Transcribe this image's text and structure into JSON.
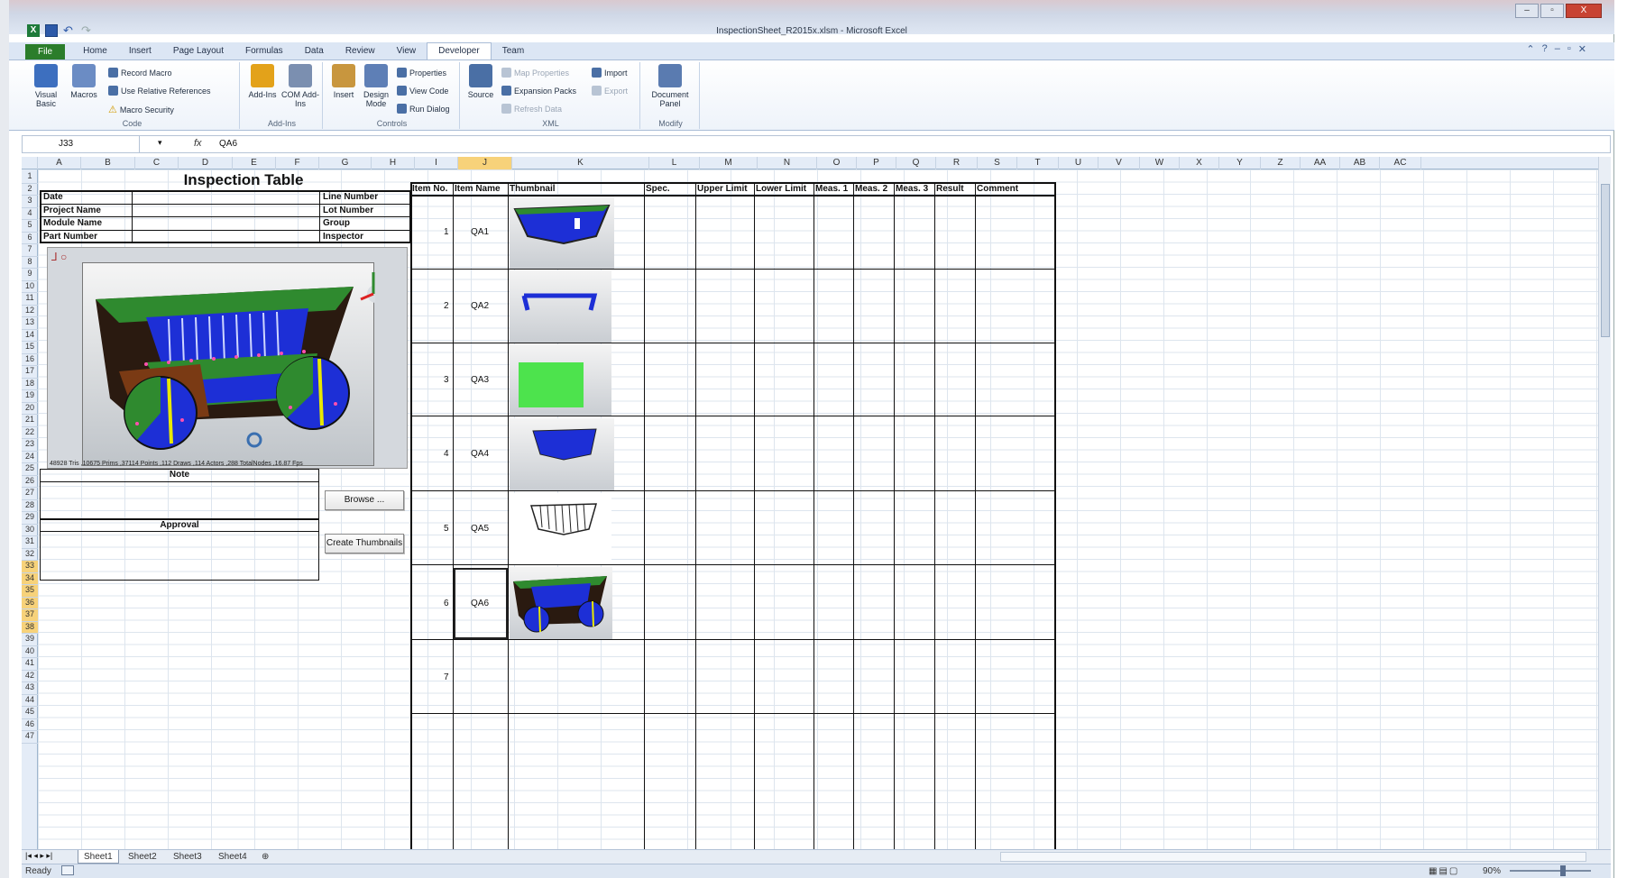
{
  "window": {
    "title": "InspectionSheet_R2015x.xlsm - Microsoft Excel",
    "controls": [
      "–",
      "▫",
      "X"
    ]
  },
  "ribbon": {
    "tabs": [
      "File",
      "Home",
      "Insert",
      "Page Layout",
      "Formulas",
      "Data",
      "Review",
      "View",
      "Developer",
      "Team"
    ],
    "active_tab": "Developer",
    "groups": {
      "code": {
        "label": "Code",
        "visual_basic": "Visual Basic",
        "macros": "Macros",
        "record_macro": "Record Macro",
        "relative_refs": "Use Relative References",
        "macro_security": "Macro Security"
      },
      "addins": {
        "label": "Add-Ins",
        "addins": "Add-Ins",
        "com_addins": "COM Add-Ins"
      },
      "controls": {
        "label": "Controls",
        "insert": "Insert",
        "design_mode": "Design Mode",
        "properties": "Properties",
        "view_code": "View Code",
        "run_dialog": "Run Dialog"
      },
      "xml": {
        "label": "XML",
        "source": "Source",
        "map_properties": "Map Properties",
        "expansion_packs": "Expansion Packs",
        "refresh_data": "Refresh Data",
        "import": "Import",
        "export": "Export"
      },
      "modify": {
        "label": "Modify",
        "document_panel": "Document Panel"
      }
    }
  },
  "formula_bar": {
    "name_box": "J33",
    "fx": "fx",
    "value": "QA6"
  },
  "columns": [
    "A",
    "B",
    "C",
    "D",
    "E",
    "F",
    "G",
    "H",
    "I",
    "J",
    "K",
    "L",
    "M",
    "N",
    "O",
    "P",
    "Q",
    "R",
    "S",
    "T",
    "U",
    "V",
    "W",
    "X",
    "Y",
    "Z",
    "AA",
    "AB",
    "AC"
  ],
  "selected_column": "J",
  "rows_selected": [
    "33",
    "34",
    "35",
    "36",
    "37",
    "38"
  ],
  "sheet": {
    "title": "Inspection Table",
    "header_left": [
      {
        "label": "Date",
        "right_label": "Line Number"
      },
      {
        "label": "Project Name",
        "right_label": "Lot Number"
      },
      {
        "label": "Module Name",
        "right_label": "Group"
      },
      {
        "label": "Part Number",
        "right_label": "Inspector"
      }
    ],
    "viewer_status": "48928 Tris ,10675 Prims ,37114 Points ,112 Draws ,114 Actors ,288 TotalNodes ,16.87 Fps",
    "note_label": "Note",
    "approval_label": "Approval",
    "browse_button": "Browse ...",
    "create_thumbnails_button": "Create Thumbnails",
    "table_headers": [
      "Item No.",
      "Item Name",
      "Thumbnail",
      "Spec.",
      "Upper Limit",
      "Lower Limit",
      "Meas. 1",
      "Meas. 2",
      "Meas. 3",
      "Result",
      "Comment"
    ],
    "items": [
      {
        "no": "1",
        "name": "QA1"
      },
      {
        "no": "2",
        "name": "QA2"
      },
      {
        "no": "3",
        "name": "QA3"
      },
      {
        "no": "4",
        "name": "QA4"
      },
      {
        "no": "5",
        "name": "QA5"
      },
      {
        "no": "6",
        "name": "QA6"
      },
      {
        "no": "7",
        "name": ""
      }
    ]
  },
  "sheet_tabs": [
    "Sheet1",
    "Sheet2",
    "Sheet3",
    "Sheet4"
  ],
  "active_sheet": "Sheet1",
  "status": {
    "ready": "Ready",
    "zoom": "90%"
  },
  "colors": {
    "ribbon_file": "#2b7d2b",
    "selection": "#f7d27a",
    "model_blue": "#1d2fd6",
    "model_green": "#2f8a2f"
  }
}
